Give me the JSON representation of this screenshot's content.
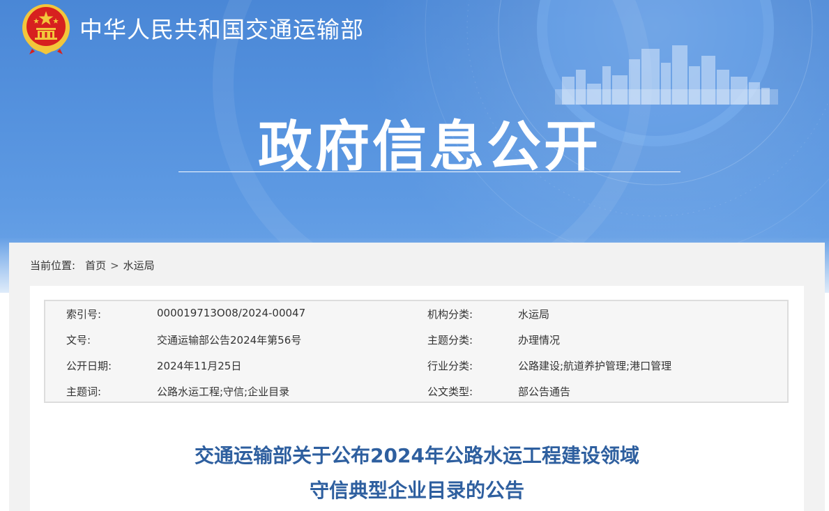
{
  "header": {
    "site_title": "中华人民共和国交通运输部",
    "banner_title": "政府信息公开"
  },
  "breadcrumb": {
    "label": "当前位置:",
    "items": [
      "首页",
      "水运局"
    ],
    "separator": ">"
  },
  "meta": {
    "rows": [
      {
        "k1": "索引号:",
        "v1": "000019713O08/2024-00047",
        "k2": "机构分类:",
        "v2": "水运局"
      },
      {
        "k1": "文号:",
        "v1": "交通运输部公告2024年第56号",
        "k2": "主题分类:",
        "v2": "办理情况"
      },
      {
        "k1": "公开日期:",
        "v1": "2024年11月25日",
        "k2": "行业分类:",
        "v2": "公路建设;航道养护管理;港口管理"
      },
      {
        "k1": "主题词:",
        "v1": "公路水运工程;守信;企业目录",
        "k2": "公文类型:",
        "v2": "部公告通告"
      }
    ]
  },
  "document": {
    "title_line1": "交通运输部关于公布2024年公路水运工程建设领域",
    "title_line2": "守信典型企业目录的公告"
  },
  "colors": {
    "banner_blue": "#4a87d6",
    "title_blue": "#2e5f9f",
    "panel_gray": "#f2f2f2",
    "emblem_red": "#d7201f",
    "emblem_gold": "#f3c63b"
  }
}
